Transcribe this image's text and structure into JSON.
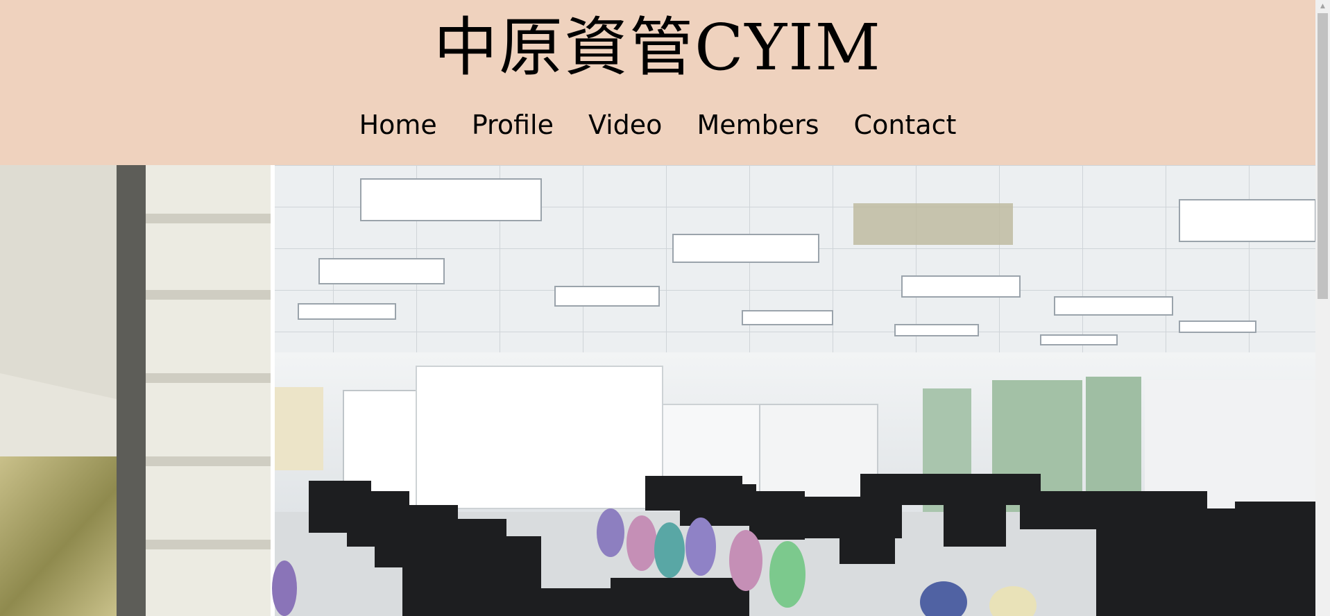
{
  "header": {
    "title": "中原資管CYIM",
    "background": "#efd2be"
  },
  "nav": {
    "items": [
      {
        "label": "Home"
      },
      {
        "label": "Profile"
      },
      {
        "label": "Video"
      },
      {
        "label": "Members"
      },
      {
        "label": "Contact"
      }
    ]
  },
  "hero": {
    "image_description": "computer-classroom-photo"
  },
  "scrollbar": {
    "up_arrow": "triangle-up-icon"
  }
}
